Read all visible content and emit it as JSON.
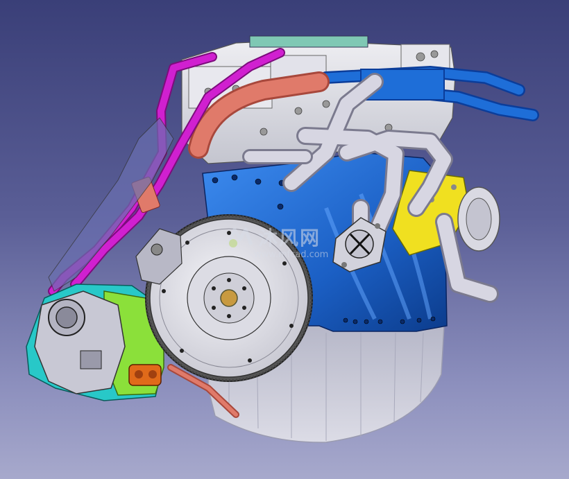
{
  "viewer": {
    "background_top": "#3a3f78",
    "background_bottom": "#a7a9cc",
    "model_subject": "engine-assembly"
  },
  "parts": {
    "colors": {
      "flywheel": "#e4e4ea",
      "engine_block": "#1b5fc4",
      "head": "#dcdde2",
      "exhaust_manifold": "#d7d6e2",
      "magenta_hoses": "#d020d0",
      "salmon_pipe": "#e07a6a",
      "blue_pipes": "#1e6ed8",
      "yellow_bracket": "#f0e020",
      "green_housing": "#8be03a",
      "cyan_cover": "#28c8c8",
      "oil_pan": "#c9c9d6",
      "orange_sensor": "#e06a1a"
    }
  },
  "watermark": {
    "logo_icon": "mfcad-logo-icon",
    "text_cn": "沐风网",
    "text_url": "www.mfcad.com"
  }
}
